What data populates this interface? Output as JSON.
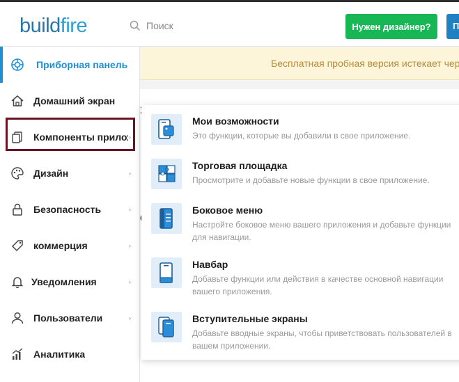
{
  "brand": {
    "part1": "build",
    "part2": "fire"
  },
  "search": {
    "placeholder": "Поиск"
  },
  "header": {
    "designer_button": "Нужен дизайнер?",
    "edge_button": "П"
  },
  "banner": {
    "text": "Бесплатная пробная версия истекает через"
  },
  "sidebar": {
    "items": [
      {
        "label": "Приборная панель",
        "icon": "dashboard-icon",
        "active": true
      },
      {
        "label": "Домашний экран",
        "icon": "home-icon"
      },
      {
        "label": "Компоненты приложения",
        "icon": "components-icon",
        "has_submenu": true
      },
      {
        "label": "Дизайн",
        "icon": "palette-icon",
        "has_submenu": true
      },
      {
        "label": "Безопасность",
        "icon": "lock-icon",
        "has_submenu": true
      },
      {
        "label": "коммерция",
        "icon": "tag-icon",
        "has_submenu": true
      },
      {
        "label": "Уведомления",
        "icon": "bell-icon",
        "has_submenu": true
      },
      {
        "label": "Пользователи",
        "icon": "user-icon",
        "has_submenu": true
      },
      {
        "label": "Аналитика",
        "icon": "analytics-icon"
      }
    ],
    "chevron": "›"
  },
  "dropdown": {
    "items": [
      {
        "title": "Мои возможности",
        "desc": "Это функции, которые вы добавили в свое приложение.",
        "icon": "my-features-icon"
      },
      {
        "title": "Торговая площадка",
        "desc": "Просмотрите и добавьте новые функции в свое приложение.",
        "icon": "puzzle-icon"
      },
      {
        "title": "Боковое меню",
        "desc": "Настройте боковое меню вашего приложения и добавьте функции для навигации.",
        "icon": "side-menu-icon"
      },
      {
        "title": "Навбар",
        "desc": "Добавьте функции или действия в качестве основной навигации вашего приложения.",
        "icon": "navbar-icon"
      },
      {
        "title": "Вступительные экраны",
        "desc": "Добавьте вводные экраны, чтобы приветствовать пользователей в вашем приложении.",
        "icon": "intro-screens-icon"
      }
    ]
  },
  "colors": {
    "accent": "#1f8fd5",
    "green": "#16b754",
    "highlight": "#6b1524",
    "banner_text": "#b78b3c"
  }
}
